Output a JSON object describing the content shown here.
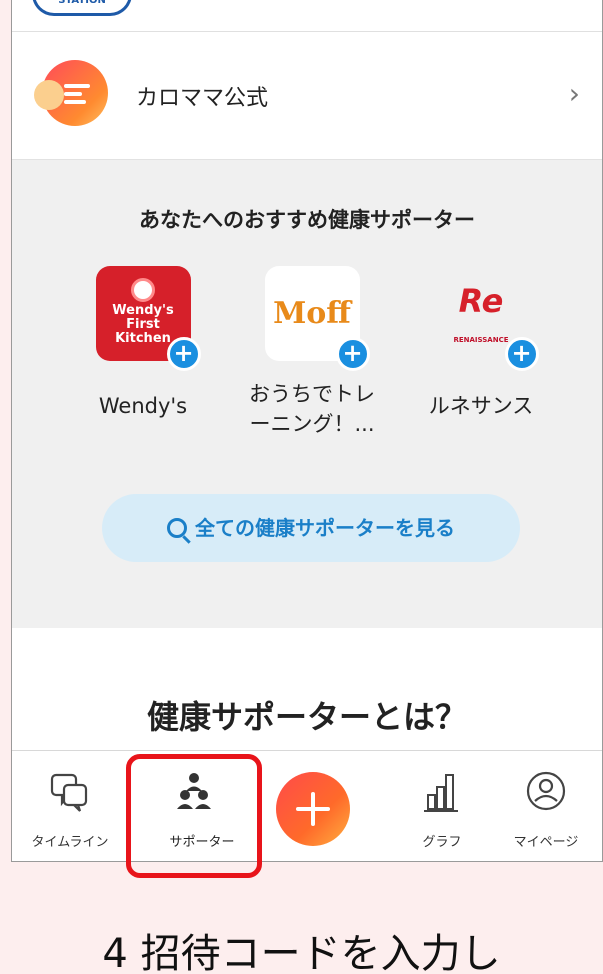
{
  "official": {
    "label": "カロママ公式",
    "chevron": "›"
  },
  "recommend": {
    "title": "あなたへのおすすめ健康サポーター",
    "supporters": [
      {
        "name": "Wendy's",
        "logo_text_1": "Wendy's",
        "logo_text_2": "First",
        "logo_text_3": "Kitchen",
        "badge": "+"
      },
      {
        "name": "おうちでトレーニング！...",
        "name_line1": "おうちでトレ",
        "name_line2": "ーニング！...",
        "logo_text": "Moff",
        "badge": "+"
      },
      {
        "name": "ルネサンス",
        "logo_text": "Re",
        "logo_sub": "RENAISSANCE",
        "badge": "+"
      }
    ],
    "view_all": "全ての健康サポーターを見る"
  },
  "what": {
    "title": "健康サポーターとは？"
  },
  "tabbar": {
    "tabs": [
      {
        "label": "タイムライン",
        "icon": "chat-bubbles-icon"
      },
      {
        "label": "サポーター",
        "icon": "people-icon"
      },
      {
        "label": "",
        "icon": "plus-icon"
      },
      {
        "label": "グラフ",
        "icon": "bar-chart-icon"
      },
      {
        "label": "マイページ",
        "icon": "user-circle-icon"
      }
    ]
  },
  "caption": "4 招待コードを入力し",
  "colors": {
    "accent_blue": "#1a8fe0",
    "highlight_red": "#e8141a",
    "fab_orange": "#ff6a2a",
    "page_bg": "#fdeeee"
  }
}
